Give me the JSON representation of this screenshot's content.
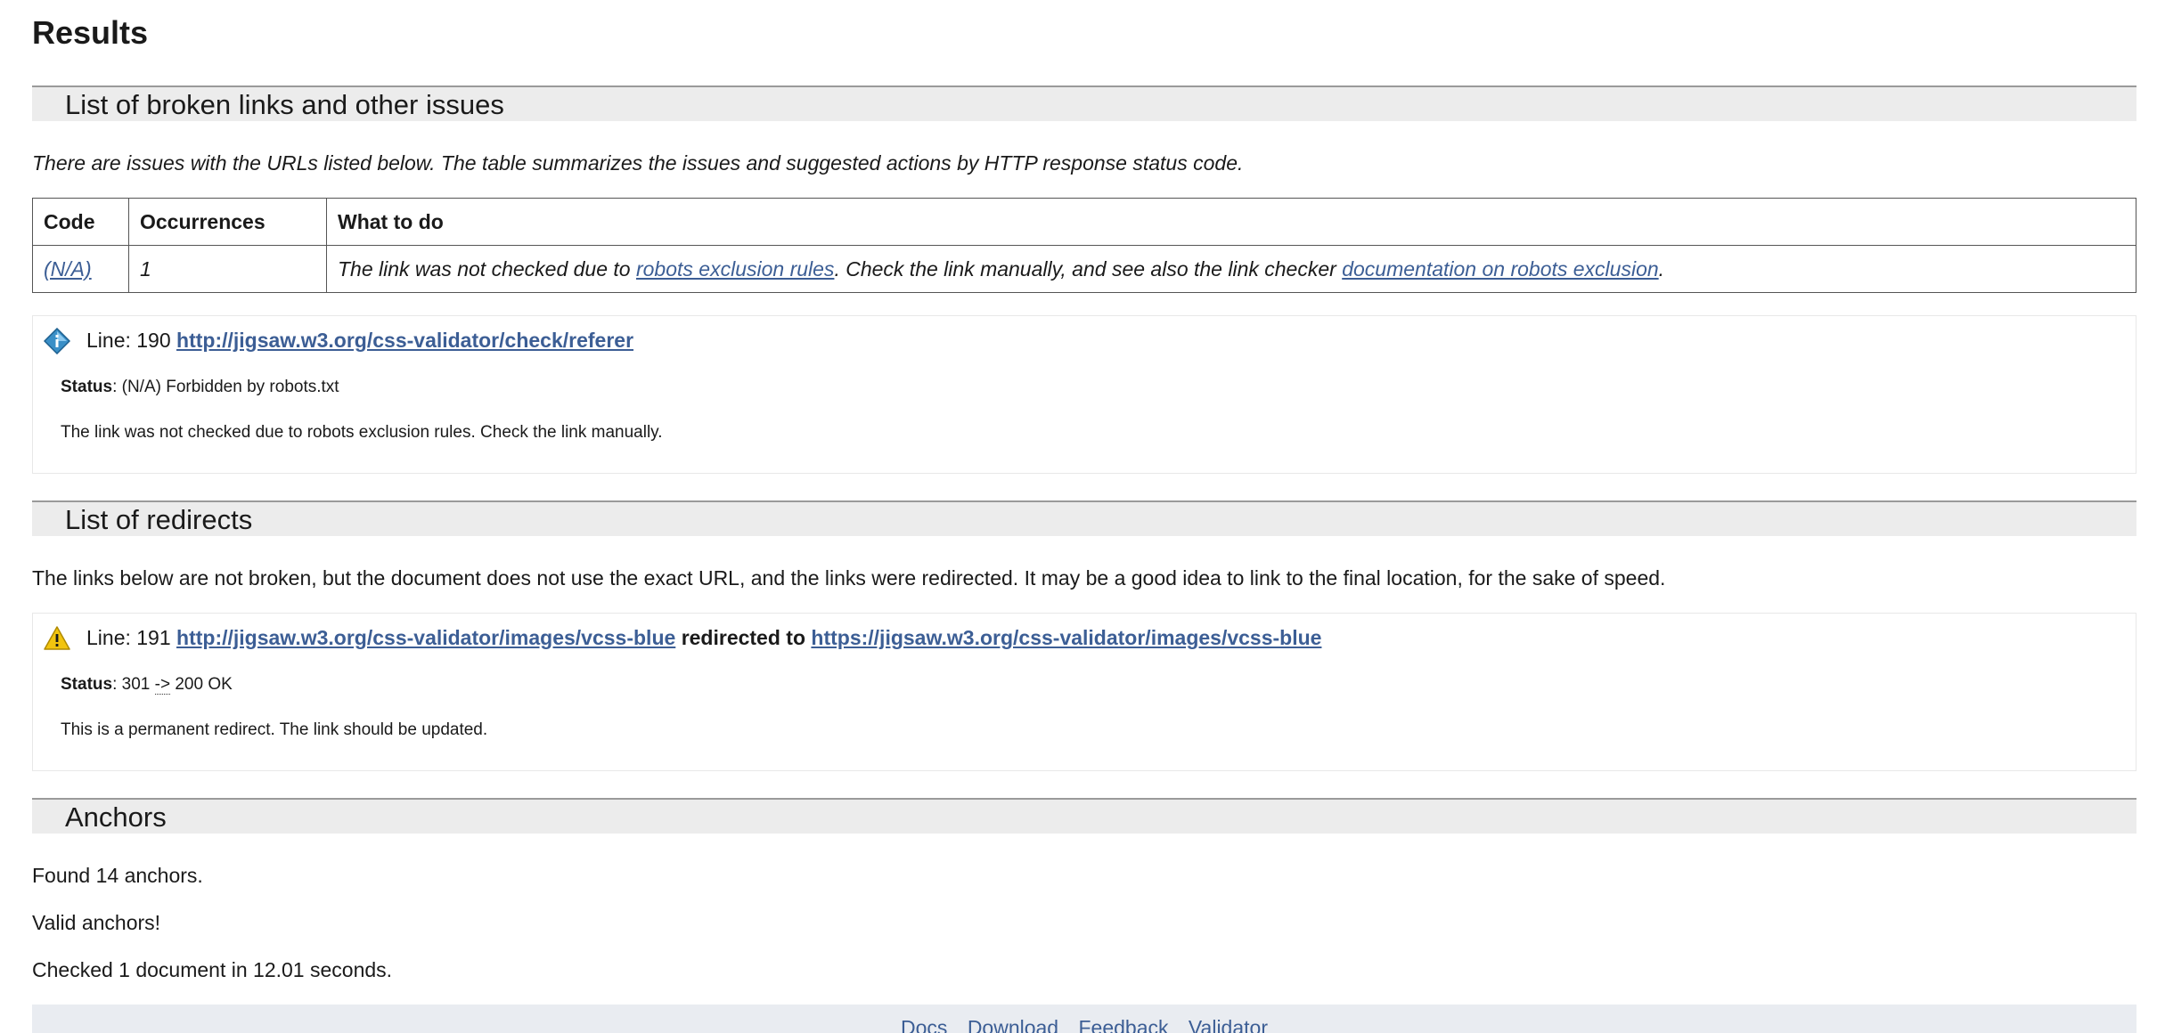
{
  "results": {
    "title": "Results"
  },
  "broken_links": {
    "header": "List of broken links and other issues",
    "intro": "There are issues with the URLs listed below. The table summarizes the issues and suggested actions by HTTP response status code.",
    "table": {
      "headers": [
        "Code",
        "Occurrences",
        "What to do"
      ],
      "rows": [
        {
          "code": "(N/A)",
          "occurrences": "1",
          "what_prefix": "The link was not checked due to ",
          "link1": "robots exclusion rules",
          "what_middle": ". Check the link manually, and see also the link checker ",
          "link2": "documentation on robots exclusion",
          "what_suffix": "."
        }
      ]
    },
    "item": {
      "line_label": "Line: 190",
      "url": "http://jigsaw.w3.org/css-validator/check/referer",
      "status_label": "Status",
      "status_value": ": (N/A) Forbidden by robots.txt",
      "description": "The link was not checked due to robots exclusion rules. Check the link manually.",
      "icon": "info-diamond-icon",
      "icon_color": "#3a8fc7"
    }
  },
  "redirects": {
    "header": "List of redirects",
    "intro": "The links below are not broken, but the document does not use the exact URL, and the links were redirected. It may be a good idea to link to the final location, for the sake of speed.",
    "item": {
      "line_label": "Line: 191",
      "from_url": "http://jigsaw.w3.org/css-validator/images/vcss-blue",
      "redirected_to": "redirected to",
      "to_url": "https://jigsaw.w3.org/css-validator/images/vcss-blue",
      "status_label": "Status",
      "status_prefix": ": 301 ",
      "status_arrow": "->",
      "status_suffix": " 200 OK",
      "description": "This is a permanent redirect. The link should be updated.",
      "icon": "warning-icon",
      "icon_color": "#f2c40f"
    }
  },
  "anchors": {
    "header": "Anchors",
    "found": "Found 14 anchors.",
    "valid": "Valid anchors!",
    "checked": "Checked 1 document in 12.01 seconds."
  },
  "footer": {
    "links": [
      "Docs",
      "Download",
      "Feedback",
      "Validator"
    ]
  },
  "colors": {
    "link": "#3c5e95",
    "section_bg": "#ececec",
    "footer_bg": "#e9ecf1"
  }
}
